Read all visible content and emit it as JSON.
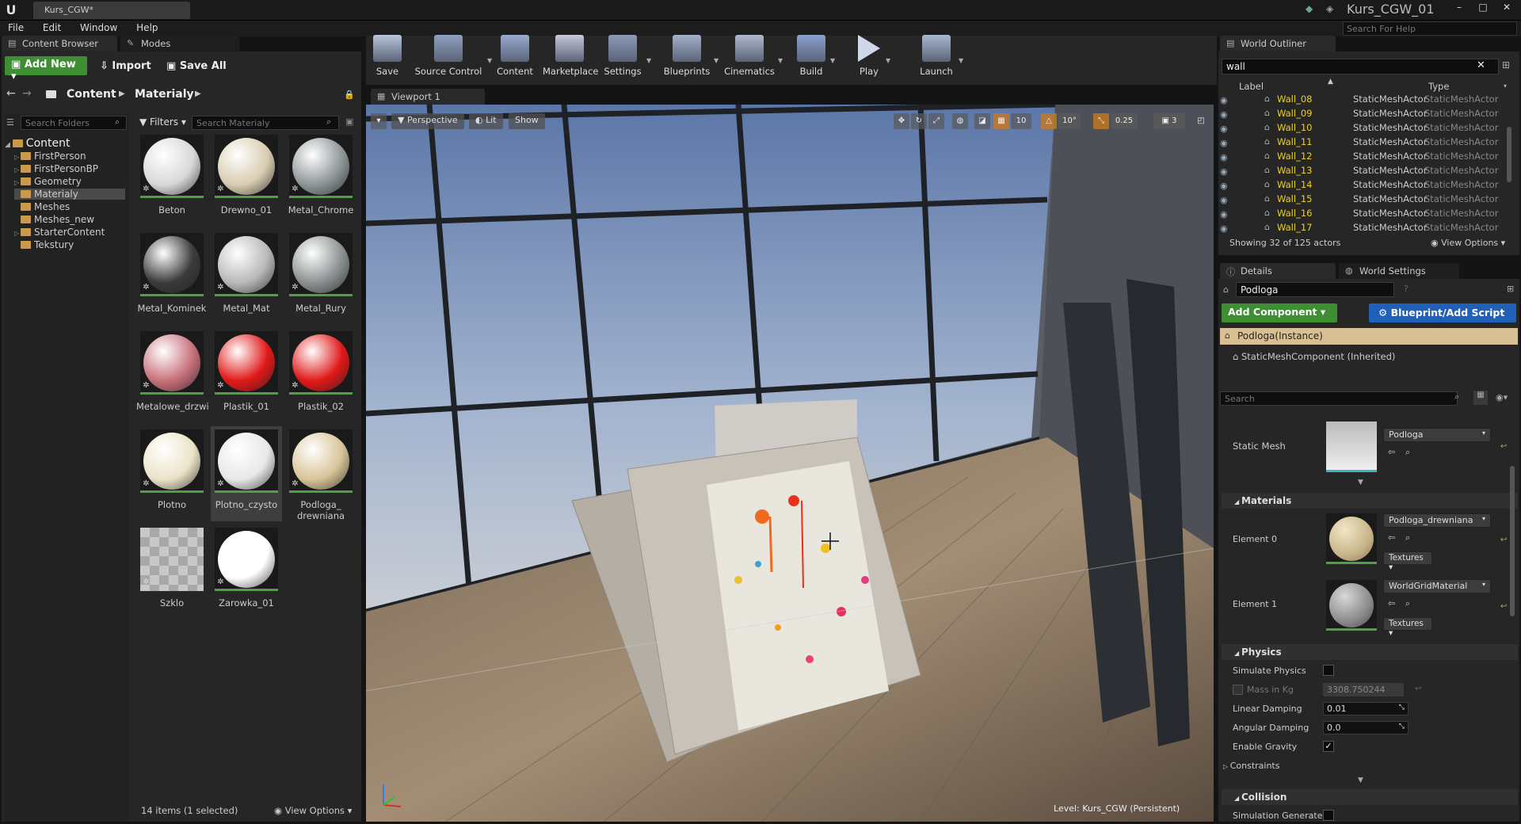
{
  "window": {
    "doc_tab": "Kurs_CGW*",
    "project_name": "Kurs_CGW_01",
    "help_placeholder": "Search For Help",
    "menu": [
      "File",
      "Edit",
      "Window",
      "Help"
    ]
  },
  "content_browser": {
    "tab_label": "Content Browser",
    "modes_tab_label": "Modes",
    "add_new": "Add New",
    "import": "Import",
    "save_all": "Save All",
    "path": [
      "Content",
      "Materialy"
    ],
    "folder_search_placeholder": "Search Folders",
    "filters_label": "Filters",
    "asset_search_placeholder": "Search Materialy",
    "tree_root": "Content",
    "tree": [
      "FirstPerson",
      "FirstPersonBP",
      "Geometry",
      "Materialy",
      "Meshes",
      "Meshes_new",
      "StarterContent",
      "Tekstury"
    ],
    "selected_folder": "Materialy",
    "assets": [
      {
        "name": "Beton",
        "color": "#d8d8d8"
      },
      {
        "name": "Drewno_01",
        "color": "#d9ccb0"
      },
      {
        "name": "Metal_Chrome",
        "color": "#8e9698"
      },
      {
        "name": "Metal_Kominek",
        "color": "#3a3a3a"
      },
      {
        "name": "Metal_Mat",
        "color": "#b8b8b8"
      },
      {
        "name": "Metal_Rury",
        "color": "#8a9090"
      },
      {
        "name": "Metalowe_drzwi",
        "color": "#c8707a"
      },
      {
        "name": "Plastik_01",
        "color": "#e01818"
      },
      {
        "name": "Plastik_02",
        "color": "#e01818"
      },
      {
        "name": "Plotno",
        "color": "#ebe3c8"
      },
      {
        "name": "Plotno_czysto",
        "color": "#e8e8e8"
      },
      {
        "name": "Podloga_ drewniana",
        "color": "#d8c498"
      },
      {
        "name": "Szklo",
        "color": "#b8b8b8"
      },
      {
        "name": "Zarowka_01",
        "color": "#ffffff"
      }
    ],
    "selected_asset": "Plotno_czysto",
    "status": "14 items (1 selected)",
    "view_options": "View Options"
  },
  "toolbar": {
    "buttons": [
      {
        "label": "Save",
        "icon": "save-icon"
      },
      {
        "label": "Source Control",
        "icon": "source-control-icon"
      },
      {
        "label": "Content",
        "icon": "content-icon"
      },
      {
        "label": "Marketplace",
        "icon": "marketplace-icon"
      },
      {
        "label": "Settings",
        "icon": "settings-icon"
      },
      {
        "label": "Blueprints",
        "icon": "blueprints-icon"
      },
      {
        "label": "Cinematics",
        "icon": "cinematics-icon"
      },
      {
        "label": "Build",
        "icon": "build-icon"
      },
      {
        "label": "Play",
        "icon": "play-icon"
      },
      {
        "label": "Launch",
        "icon": "launch-icon"
      }
    ]
  },
  "viewport": {
    "tab_label": "Viewport 1",
    "perspective": "Perspective",
    "lit": "Lit",
    "show": "Show",
    "grid_snap": "10",
    "rot_snap": "10°",
    "scale_snap": "0.25",
    "camera_speed": "3",
    "level_label": "Level:  Kurs_CGW (Persistent)"
  },
  "outliner": {
    "tab_label": "World Outliner",
    "search_value": "wall",
    "col_label": "Label",
    "col_type": "Type",
    "rows": [
      {
        "label": "Wall_08",
        "type": "StaticMeshActor",
        "type2": "StaticMeshActor"
      },
      {
        "label": "Wall_09",
        "type": "StaticMeshActor",
        "type2": "StaticMeshActor"
      },
      {
        "label": "Wall_10",
        "type": "StaticMeshActor",
        "type2": "StaticMeshActor"
      },
      {
        "label": "Wall_11",
        "type": "StaticMeshActor",
        "type2": "StaticMeshActor"
      },
      {
        "label": "Wall_12",
        "type": "StaticMeshActor",
        "type2": "StaticMeshActor"
      },
      {
        "label": "Wall_13",
        "type": "StaticMeshActor",
        "type2": "StaticMeshActor"
      },
      {
        "label": "Wall_14",
        "type": "StaticMeshActor",
        "type2": "StaticMeshActor"
      },
      {
        "label": "Wall_15",
        "type": "StaticMeshActor",
        "type2": "StaticMeshActor"
      },
      {
        "label": "Wall_16",
        "type": "StaticMeshActor",
        "type2": "StaticMeshActor"
      },
      {
        "label": "Wall_17",
        "type": "StaticMeshActor",
        "type2": "StaticMeshActor"
      }
    ],
    "status": "Showing 32 of 125 actors",
    "view_options": "View Options"
  },
  "details": {
    "tab_label": "Details",
    "world_settings_tab": "World Settings",
    "actor_name": "Podloga",
    "add_component": "Add Component",
    "blueprint_script": "Blueprint/Add Script",
    "instance": "Podloga(Instance)",
    "component": "StaticMeshComponent (Inherited)",
    "search_placeholder": "Search",
    "static_mesh_label": "Static Mesh",
    "static_mesh_value": "Podloga",
    "materials_header": "Materials",
    "element0_label": "Element 0",
    "element0_value": "Podloga_drewniana",
    "element1_label": "Element 1",
    "element1_value": "WorldGridMaterial",
    "textures": "Textures",
    "physics_header": "Physics",
    "simulate_physics": "Simulate Physics",
    "mass_label": "Mass in Kg",
    "mass_value": "3308.750244",
    "linear_damping_label": "Linear Damping",
    "linear_damping": "0.01",
    "angular_damping_label": "Angular Damping",
    "angular_damping": "0.0",
    "enable_gravity": "Enable Gravity",
    "constraints": "Constraints",
    "collision_header": "Collision",
    "simulation_generates": "Simulation Generates"
  }
}
